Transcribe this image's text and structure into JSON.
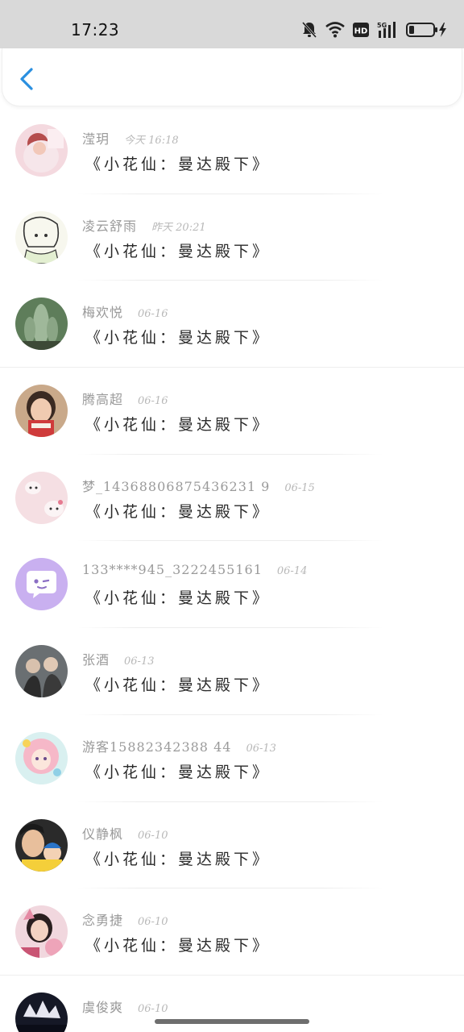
{
  "status_bar": {
    "time": "17:23",
    "icons": [
      "bell-mute-icon",
      "wifi-icon",
      "hd-icon",
      "5g-signal-icon",
      "battery-charging-icon"
    ],
    "network": "5G",
    "hd": "HD"
  },
  "nav": {
    "back_icon": "chevron-left-icon",
    "accent": "#2a8fe0"
  },
  "items": [
    {
      "name": "滢玥",
      "time": "今天 16:18",
      "message": "《小花仙：曼达殿下》"
    },
    {
      "name": "凌云舒雨",
      "time": "昨天 20:21",
      "message": "《小花仙：曼达殿下》"
    },
    {
      "name": "梅欢悦",
      "time": "06-16",
      "message": "《小花仙：曼达殿下》"
    },
    {
      "name": "腾高超",
      "time": "06-16",
      "message": "《小花仙：曼达殿下》"
    },
    {
      "name": "梦_14368806875436231 9",
      "time": "06-15",
      "message": "《小花仙：曼达殿下》"
    },
    {
      "name": "133****945_3222455161",
      "time": "06-14",
      "message": "《小花仙：曼达殿下》"
    },
    {
      "name": "张酒",
      "time": "06-13",
      "message": "《小花仙：曼达殿下》"
    },
    {
      "name": "游客15882342388 44",
      "time": "06-13",
      "message": "《小花仙：曼达殿下》"
    },
    {
      "name": "仪静枫",
      "time": "06-10",
      "message": "《小花仙：曼达殿下》"
    },
    {
      "name": "念勇捷",
      "time": "06-10",
      "message": "《小花仙：曼达殿下》"
    },
    {
      "name": "虞俊爽",
      "time": "06-10",
      "message": ""
    }
  ]
}
